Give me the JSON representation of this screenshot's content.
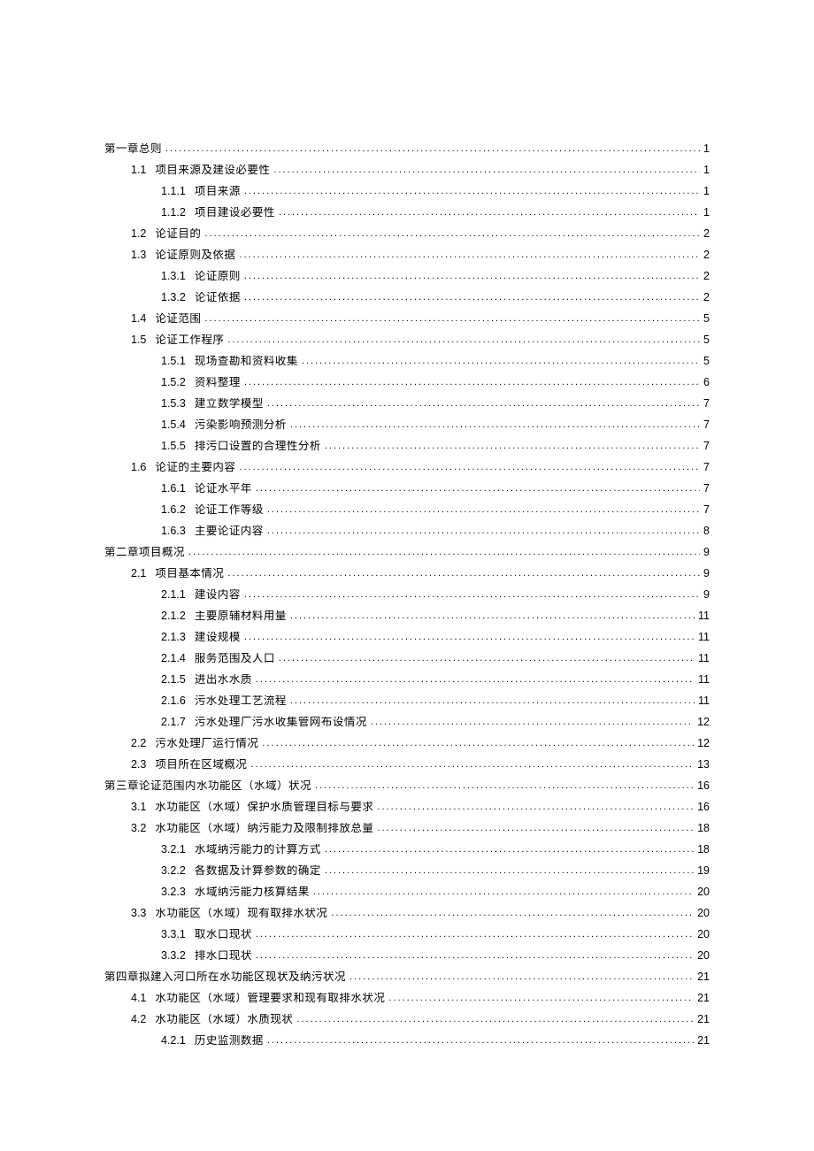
{
  "toc": [
    {
      "level": 0,
      "num": "",
      "title": "第一章总则",
      "page": "1"
    },
    {
      "level": 1,
      "num": "1.1",
      "title": "项目来源及建设必要性",
      "page": "1"
    },
    {
      "level": 2,
      "num": "1.1.1",
      "title": "项目来源",
      "page": "1"
    },
    {
      "level": 2,
      "num": "1.1.2",
      "title": "项目建设必要性",
      "page": "1"
    },
    {
      "level": 1,
      "num": "1.2",
      "title": "论证目的",
      "page": "2"
    },
    {
      "level": 1,
      "num": "1.3",
      "title": "论证原则及依据",
      "page": "2"
    },
    {
      "level": 2,
      "num": "1.3.1",
      "title": "论证原则",
      "page": "2"
    },
    {
      "level": 2,
      "num": "1.3.2",
      "title": "论证依据",
      "page": "2"
    },
    {
      "level": 1,
      "num": "1.4",
      "title": "论证范围",
      "page": "5"
    },
    {
      "level": 1,
      "num": "1.5",
      "title": "论证工作程序",
      "page": "5"
    },
    {
      "level": 2,
      "num": "1.5.1",
      "title": "现场查勘和资料收集",
      "page": "5"
    },
    {
      "level": 2,
      "num": "1.5.2",
      "title": "资料整理",
      "page": "6"
    },
    {
      "level": 2,
      "num": "1.5.3",
      "title": "建立数学模型",
      "page": "7"
    },
    {
      "level": 2,
      "num": "1.5.4",
      "title": "污染影响预测分析",
      "page": "7"
    },
    {
      "level": 2,
      "num": "1.5.5",
      "title": "排污口设置的合理性分析",
      "page": "7"
    },
    {
      "level": 1,
      "num": "1.6",
      "title": "论证的主要内容",
      "page": "7"
    },
    {
      "level": 2,
      "num": "1.6.1",
      "title": "论证水平年",
      "page": "7"
    },
    {
      "level": 2,
      "num": "1.6.2",
      "title": "论证工作等级",
      "page": "7"
    },
    {
      "level": 2,
      "num": "1.6.3",
      "title": "主要论证内容",
      "page": "8"
    },
    {
      "level": 0,
      "num": "",
      "title": "第二章项目概况",
      "page": "9"
    },
    {
      "level": 1,
      "num": "2.1",
      "title": "项目基本情况",
      "page": "9"
    },
    {
      "level": 2,
      "num": "2.1.1",
      "title": "建设内容",
      "page": "9"
    },
    {
      "level": 2,
      "num": "2.1.2",
      "title": "主要原辅材料用量",
      "page": "11"
    },
    {
      "level": 2,
      "num": "2.1.3",
      "title": "建设规模",
      "page": "11"
    },
    {
      "level": 2,
      "num": "2.1.4",
      "title": "服务范围及人口",
      "page": "11"
    },
    {
      "level": 2,
      "num": "2.1.5",
      "title": "进出水水质",
      "page": "11"
    },
    {
      "level": 2,
      "num": "2.1.6",
      "title": "污水处理工艺流程",
      "page": "11"
    },
    {
      "level": 2,
      "num": "2.1.7",
      "title": "污水处理厂污水收集管网布设情况",
      "page": "12"
    },
    {
      "level": 1,
      "num": "2.2",
      "title": "污水处理厂运行情况",
      "page": "12"
    },
    {
      "level": 1,
      "num": "2.3",
      "title": "项目所在区域概况",
      "page": "13"
    },
    {
      "level": 0,
      "num": "",
      "title": "第三章论证范围内水功能区（水域）状况",
      "page": "16"
    },
    {
      "level": 1,
      "num": "3.1",
      "title": "水功能区（水域）保护水质管理目标与要求",
      "page": "16"
    },
    {
      "level": 1,
      "num": "3.2",
      "title": "水功能区（水域）纳污能力及限制排放总量",
      "page": "18"
    },
    {
      "level": 2,
      "num": "3.2.1",
      "title": "水域纳污能力的计算方式",
      "page": "18"
    },
    {
      "level": 2,
      "num": "3.2.2",
      "title": "各数据及计算参数的确定",
      "page": "19"
    },
    {
      "level": 2,
      "num": "3.2.3",
      "title": "水域纳污能力核算结果",
      "page": "20"
    },
    {
      "level": 1,
      "num": "3.3",
      "title": "水功能区（水域）现有取排水状况",
      "page": "20"
    },
    {
      "level": 2,
      "num": "3.3.1",
      "title": "取水口现状",
      "page": "20"
    },
    {
      "level": 2,
      "num": "3.3.2",
      "title": "排水口现状",
      "page": "20"
    },
    {
      "level": 0,
      "num": "",
      "title": "第四章拟建入河口所在水功能区现状及纳污状况",
      "page": "21"
    },
    {
      "level": 1,
      "num": "4.1",
      "title": "水功能区（水域）管理要求和现有取排水状况",
      "page": "21"
    },
    {
      "level": 1,
      "num": "4.2",
      "title": "水功能区（水域）水质现状",
      "page": "21"
    },
    {
      "level": 2,
      "num": "4.2.1",
      "title": "历史监测数据",
      "page": "21"
    }
  ]
}
